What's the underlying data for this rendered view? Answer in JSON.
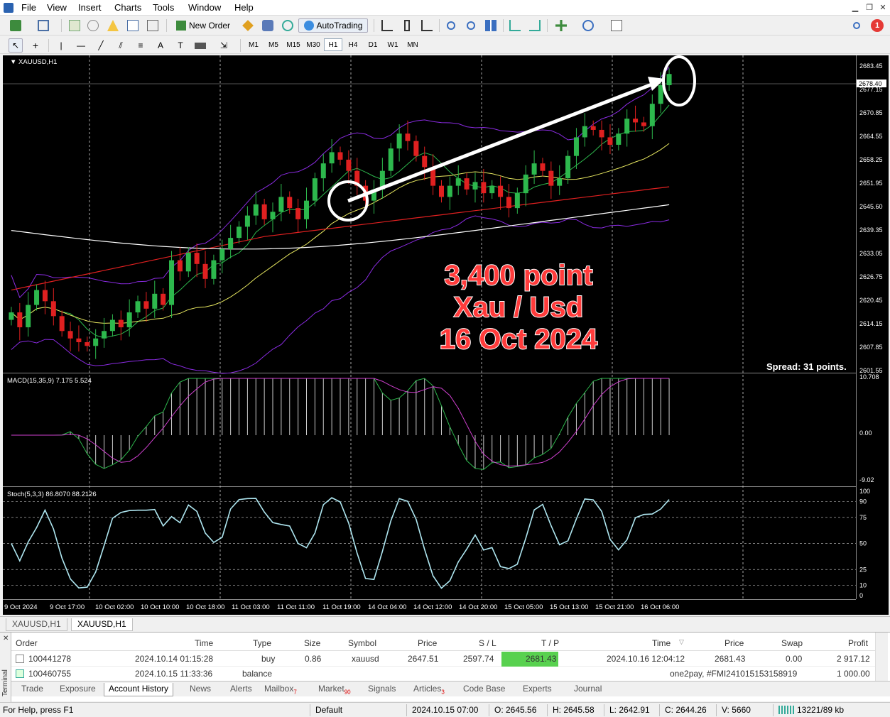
{
  "menu": [
    "File",
    "View",
    "Insert",
    "Charts",
    "Tools",
    "Window",
    "Help"
  ],
  "toolbar": {
    "new_order": "New Order",
    "autotrading": "AutoTrading",
    "notification_count": "1"
  },
  "timeframes": [
    "M1",
    "M5",
    "M15",
    "M30",
    "H1",
    "H4",
    "D1",
    "W1",
    "MN"
  ],
  "active_timeframe": "H1",
  "chart": {
    "symbol_label": "XAUUSD,H1",
    "current_price": "2678.40",
    "price_ticks": [
      "2683.45",
      "2677.15",
      "2670.85",
      "2664.55",
      "2658.25",
      "2651.95",
      "2645.60",
      "2639.35",
      "2633.05",
      "2626.75",
      "2620.45",
      "2614.15",
      "2607.85",
      "2601.55"
    ],
    "time_ticks": [
      "9 Oct 2024",
      "9 Oct 17:00",
      "10 Oct 02:00",
      "10 Oct 10:00",
      "10 Oct 18:00",
      "11 Oct 03:00",
      "11 Oct 11:00",
      "11 Oct 19:00",
      "14 Oct 04:00",
      "14 Oct 12:00",
      "14 Oct 20:00",
      "15 Oct 05:00",
      "15 Oct 13:00",
      "15 Oct 21:00",
      "16 Oct 06:00"
    ],
    "spread": "Spread: 31 points.",
    "annotation": [
      "3,400 point",
      "Xau / Usd",
      "16 Oct 2024"
    ],
    "macd_label": "MACD(15,35,9) 7.175 5.524",
    "macd_ticks": [
      "10.708",
      "0.00",
      "-9.02"
    ],
    "stoch_label": "Stoch(5,3,3) 86.8070 88.2126",
    "stoch_ticks": [
      "100",
      "90",
      "75",
      "50",
      "25",
      "10",
      "0"
    ]
  },
  "chart_tabs": [
    "XAUUSD,H1",
    "XAUUSD,H1"
  ],
  "terminal": {
    "side_label": "Terminal",
    "headers": [
      "Order",
      "Time",
      "Type",
      "Size",
      "Symbol",
      "Price",
      "S / L",
      "T / P",
      "Time",
      "Price",
      "Swap",
      "Profit"
    ],
    "rows": [
      {
        "order": "100441278",
        "open_time": "2024.10.14 01:15:28",
        "type": "buy",
        "size": "0.86",
        "symbol": "xauusd",
        "price": "2647.51",
        "sl": "2597.74",
        "tp": "2681.43",
        "close_time": "2024.10.16 12:04:12",
        "close_price": "2681.43",
        "swap": "0.00",
        "profit": "2 917.12"
      },
      {
        "order": "100460755",
        "open_time": "2024.10.15 11:33:36",
        "type": "balance",
        "comment": "one2pay, #FMI241015153158919",
        "profit": "1 000.00"
      }
    ],
    "tabs": [
      {
        "label": "Trade"
      },
      {
        "label": "Exposure"
      },
      {
        "label": "Account History"
      },
      {
        "label": "News"
      },
      {
        "label": "Alerts"
      },
      {
        "label": "Mailbox",
        "badge": "7"
      },
      {
        "label": "Market",
        "badge": "90"
      },
      {
        "label": "Signals"
      },
      {
        "label": "Articles",
        "badge": "3"
      },
      {
        "label": "Code Base"
      },
      {
        "label": "Experts"
      },
      {
        "label": "Journal"
      }
    ]
  },
  "status": {
    "help": "For Help, press F1",
    "profile": "Default",
    "datetime": "2024.10.15 07:00",
    "open": "O: 2645.56",
    "high": "H: 2645.58",
    "low": "L: 2642.91",
    "close": "C: 2644.26",
    "volume": "V: 5660",
    "traffic": "13221/89 kb"
  },
  "chart_data": {
    "type": "candlestick",
    "symbol": "XAUUSD",
    "timeframe": "H1",
    "ylim": [
      2600,
      2685
    ],
    "closes": [
      2616,
      2612,
      2618,
      2622,
      2619,
      2615,
      2611,
      2609,
      2608,
      2607,
      2609,
      2611,
      2614,
      2612,
      2616,
      2619,
      2617,
      2621,
      2618,
      2630,
      2627,
      2632,
      2629,
      2625,
      2630,
      2633,
      2636,
      2639,
      2642,
      2645,
      2641,
      2643,
      2647,
      2644,
      2641,
      2646,
      2652,
      2656,
      2659,
      2657,
      2654,
      2650,
      2646,
      2649,
      2654,
      2660,
      2664,
      2662,
      2658,
      2655,
      2650,
      2647,
      2650,
      2652,
      2649,
      2651,
      2648,
      2650,
      2647,
      2644,
      2648,
      2653,
      2656,
      2654,
      2650,
      2652,
      2658,
      2663,
      2666,
      2665,
      2663,
      2661,
      2664,
      2668,
      2667,
      2666,
      2672,
      2677,
      2680
    ],
    "macd": {
      "range": [
        -9.02,
        10.708
      ]
    },
    "stoch": {
      "range": [
        0,
        100
      ]
    }
  }
}
